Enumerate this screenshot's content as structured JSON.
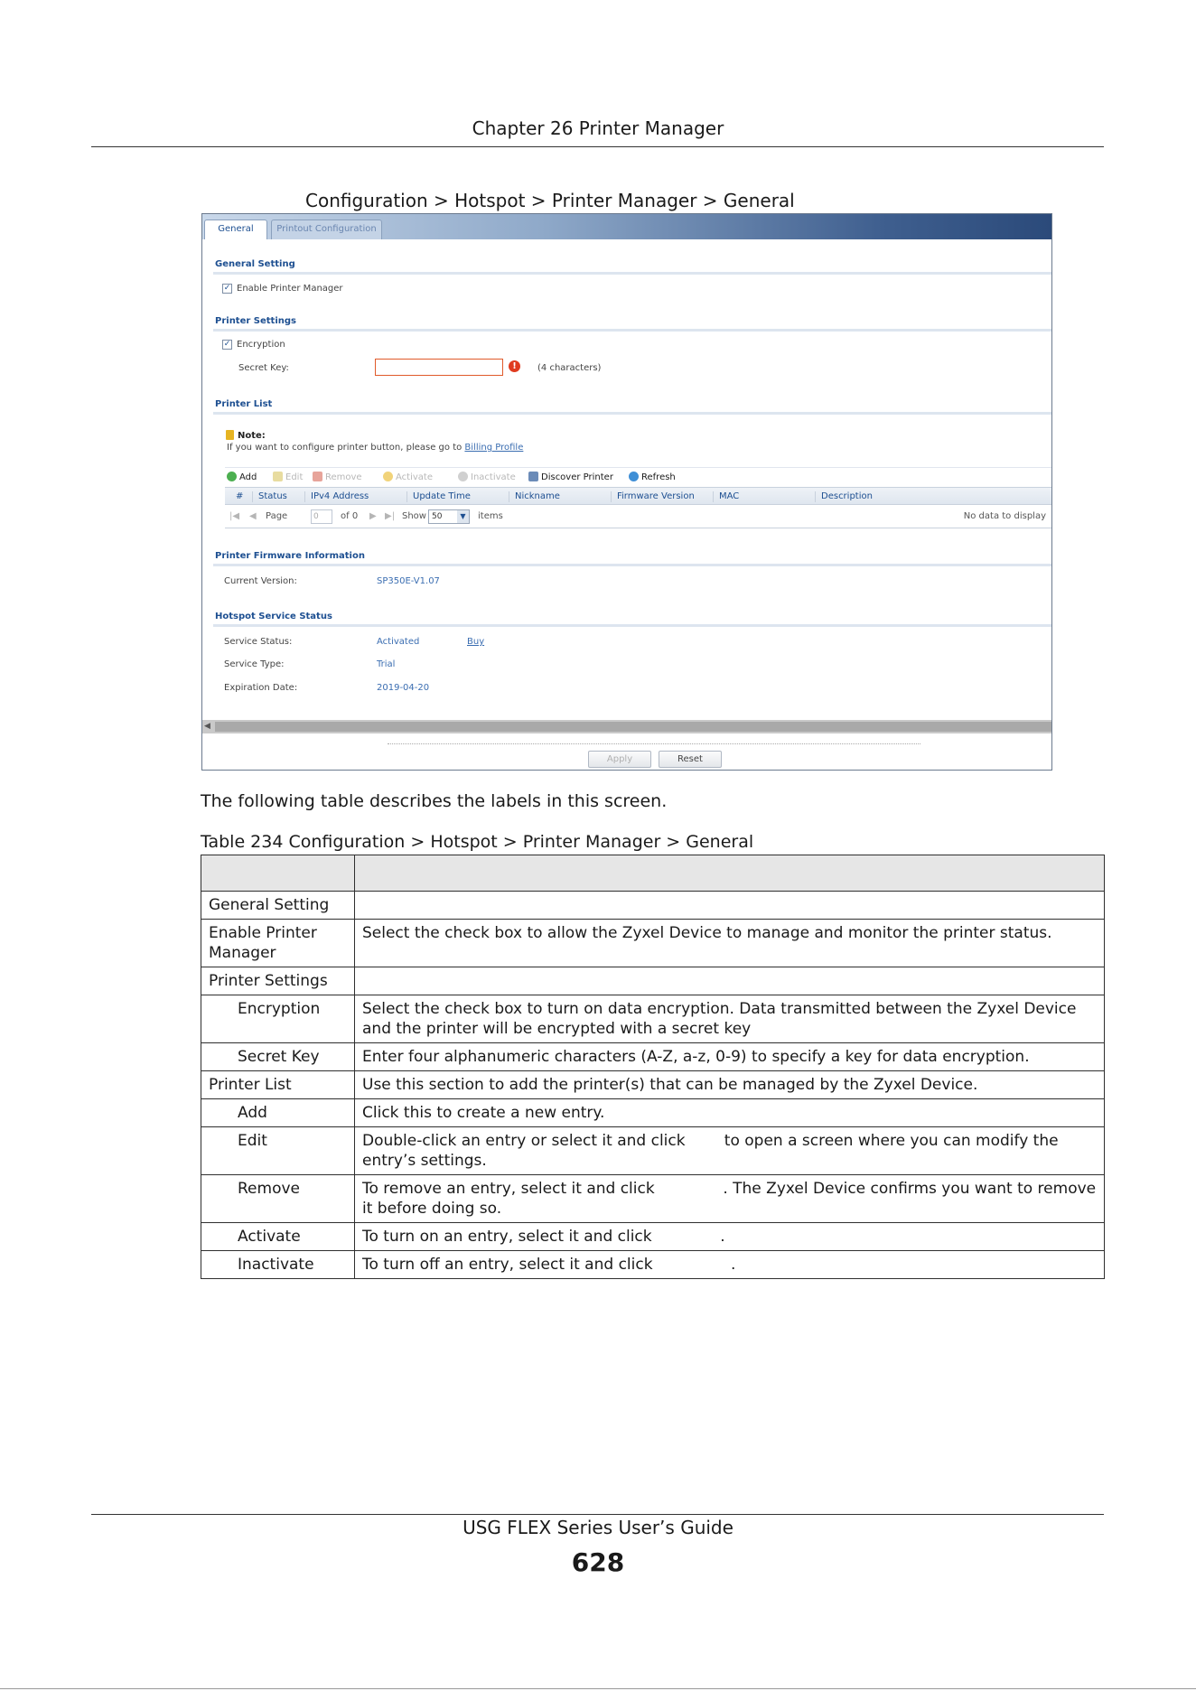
{
  "page": {
    "chapter_title": "Chapter 26 Printer Manager",
    "figure_caption": "Configuration > Hotspot > Printer Manager > General",
    "intro_text": "The following table describes the labels in this screen.",
    "table_caption": "Table 234   Configuration > Hotspot > Printer Manager > General",
    "footer_guide": "USG FLEX Series User’s Guide",
    "page_number": "628"
  },
  "screen": {
    "tabs": {
      "general": "General",
      "printout": "Printout Configuration"
    },
    "general_setting": {
      "title": "General Setting",
      "enable_label": "Enable Printer Manager",
      "enable_checked": true
    },
    "printer_settings": {
      "title": "Printer Settings",
      "encryption_label": "Encryption",
      "encryption_checked": true,
      "secret_key_label": "Secret Key:",
      "secret_key_value": "",
      "secret_key_hint": "(4 characters)"
    },
    "printer_list": {
      "title": "Printer List",
      "note_label": "Note:",
      "note_text": "If you want to configure printer button, please go to",
      "note_link": "Billing Profile",
      "toolbar": {
        "add": "Add",
        "edit": "Edit",
        "remove": "Remove",
        "activate": "Activate",
        "inactivate": "Inactivate",
        "discover": "Discover Printer",
        "refresh": "Refresh"
      },
      "columns": [
        "#",
        "Status",
        "IPv4 Address",
        "Update Time",
        "Nickname",
        "Firmware Version",
        "MAC",
        "Description"
      ],
      "pager": {
        "page_label": "Page",
        "page_value": "0",
        "of_label": "of 0",
        "show_label": "Show",
        "show_value": "50",
        "items_label": "items",
        "empty_text": "No data to display"
      }
    },
    "firmware": {
      "title": "Printer Firmware Information",
      "current_label": "Current Version:",
      "current_value": "SP350E-V1.07"
    },
    "hotspot_status": {
      "title": "Hotspot Service Status",
      "status_label": "Service Status:",
      "status_value": "Activated",
      "buy_link": "Buy",
      "type_label": "Service Type:",
      "type_value": "Trial",
      "expiration_label": "Expiration Date:",
      "expiration_value": "2019-04-20"
    },
    "buttons": {
      "apply": "Apply",
      "reset": "Reset"
    }
  },
  "table": {
    "header": [
      "",
      ""
    ],
    "rows": [
      {
        "label": "General Setting",
        "desc": "",
        "indent": false
      },
      {
        "label": "Enable Printer Manager",
        "desc": "Select the check box to allow the Zyxel Device to manage and monitor the printer status.",
        "indent": false
      },
      {
        "label": "Printer Settings",
        "desc": "",
        "indent": false
      },
      {
        "label": "Encryption",
        "desc": "Select the check box to turn on data encryption. Data transmitted between the Zyxel Device and the printer will be encrypted with a secret key",
        "indent": true
      },
      {
        "label": "Secret Key",
        "desc": "Enter four alphanumeric characters (A-Z, a-z, 0-9) to specify a key for data encryption.",
        "indent": true
      },
      {
        "label": "Printer List",
        "desc": "Use this section to add the printer(s) that can be managed by the Zyxel Device.",
        "indent": false
      },
      {
        "label": "Add",
        "desc": "Click this to create a new entry.",
        "indent": true
      },
      {
        "label": "Edit",
        "desc": "Double-click an entry or select it and click        to open a screen where you can modify the entry’s settings.",
        "indent": true
      },
      {
        "label": "Remove",
        "desc": "To remove an entry, select it and click              . The Zyxel Device confirms you want to remove it before doing so.",
        "indent": true
      },
      {
        "label": "Activate",
        "desc": "To turn on an entry, select it and click              .",
        "indent": true
      },
      {
        "label": "Inactivate",
        "desc": "To turn off an entry, select it and click                .",
        "indent": true
      }
    ]
  },
  "colors": {
    "accent": "#1d4f91",
    "link": "#3a6db1",
    "error": "#e03b1f",
    "header_gray": "#e6e6e6"
  }
}
